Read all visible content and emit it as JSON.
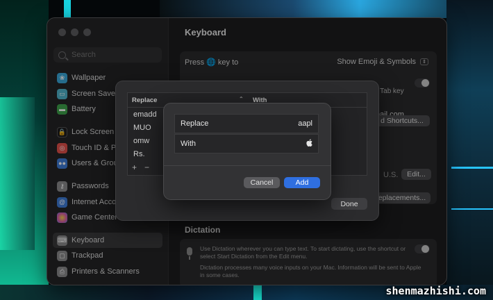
{
  "window": {
    "title": "Keyboard"
  },
  "sidebar": {
    "search_placeholder": "Search",
    "items": [
      {
        "label": "Wallpaper",
        "icon": "wallpaper-icon",
        "color": "#3aa6d8"
      },
      {
        "label": "Screen Saver",
        "icon": "screen-saver-icon",
        "color": "#4fb3c9"
      },
      {
        "label": "Battery",
        "icon": "battery-icon",
        "color": "#3ea24a"
      },
      {
        "label": "Lock Screen",
        "icon": "lock-icon",
        "color": "#1c1c1e"
      },
      {
        "label": "Touch ID & Pa",
        "icon": "fingerprint-icon",
        "color": "#e0514b"
      },
      {
        "label": "Users & Grou",
        "icon": "users-icon",
        "color": "#3e7bd6"
      },
      {
        "label": "Passwords",
        "icon": "key-icon",
        "color": "#8a8a8c"
      },
      {
        "label": "Internet Acco",
        "icon": "at-icon",
        "color": "#3e7bd6"
      },
      {
        "label": "Game Center",
        "icon": "game-center-icon",
        "color": "#d65aa8"
      },
      {
        "label": "Keyboard",
        "icon": "keyboard-icon",
        "color": "#8a8a8c"
      },
      {
        "label": "Trackpad",
        "icon": "trackpad-icon",
        "color": "#8a8a8c"
      },
      {
        "label": "Printers & Scanners",
        "icon": "printer-icon",
        "color": "#8a8a8c"
      }
    ]
  },
  "main": {
    "press_key_label": "Press 🌐 key to",
    "press_key_value": "Show Emoji & Symbols",
    "tab_key_fragment": "e Tab key",
    "email_fragment": "nail.com",
    "shortcuts_button": "d Shortcuts...",
    "input_source_value": "U.S.",
    "edit_button": "Edit...",
    "replacements_button": "eplacements...",
    "dictation_title": "Dictation",
    "dictation_desc1": "Use Dictation wherever you can type text. To start dictating, use the shortcut or select Start Dictation from the Edit menu.",
    "dictation_desc2": "Dictation processes many voice inputs on your Mac. Information will be sent to Apple in some cases."
  },
  "sheet": {
    "col_replace": "Replace",
    "col_with": "With",
    "rows": [
      "emadd",
      "MUO",
      "omw",
      "Rs."
    ],
    "add_symbol": "+",
    "remove_symbol": "−",
    "done_button": "Done"
  },
  "dialog": {
    "replace_label": "Replace",
    "replace_value": "aapl",
    "with_label": "With",
    "with_value": "",
    "cancel_button": "Cancel",
    "add_button": "Add",
    "accent_color": "#2f6fe0"
  },
  "watermark": "shenmazhishi.com"
}
